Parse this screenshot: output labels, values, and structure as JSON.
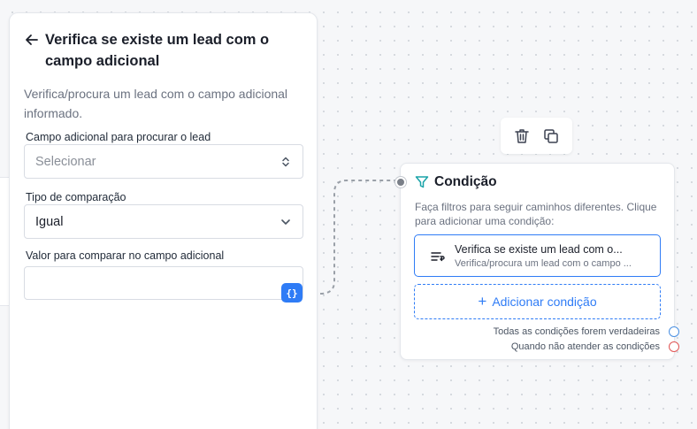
{
  "panel": {
    "title": "Verifica se existe um lead com o campo adicional",
    "description": "Verifica/procura um lead com o campo adicional informado.",
    "fields": {
      "campo_label": "Campo adicional para procurar o lead",
      "campo_placeholder": "Selecionar",
      "tipo_label": "Tipo de comparação",
      "tipo_value": "Igual",
      "valor_label": "Valor para comparar no campo adicional",
      "valor_value": "",
      "variable_button": "{}"
    }
  },
  "toolbar": {
    "delete_icon": "trash-icon",
    "duplicate_icon": "copy-icon"
  },
  "node": {
    "title": "Condição",
    "description": "Faça filtros para seguir caminhos diferentes. Clique para adicionar uma condição:",
    "condition": {
      "title": "Verifica se existe um lead com o...",
      "subtitle": "Verifica/procura um lead com o campo ..."
    },
    "add_condition_label": "Adicionar condição",
    "outputs": [
      {
        "label": "Todas as condições forem verdadeiras",
        "color": "#4a90e2"
      },
      {
        "label": "Quando não atender as condições",
        "color": "#e05555"
      }
    ]
  },
  "colors": {
    "accent": "#2f7cf6",
    "success_outlet": "#4a90e2",
    "fail_outlet": "#e05555"
  }
}
